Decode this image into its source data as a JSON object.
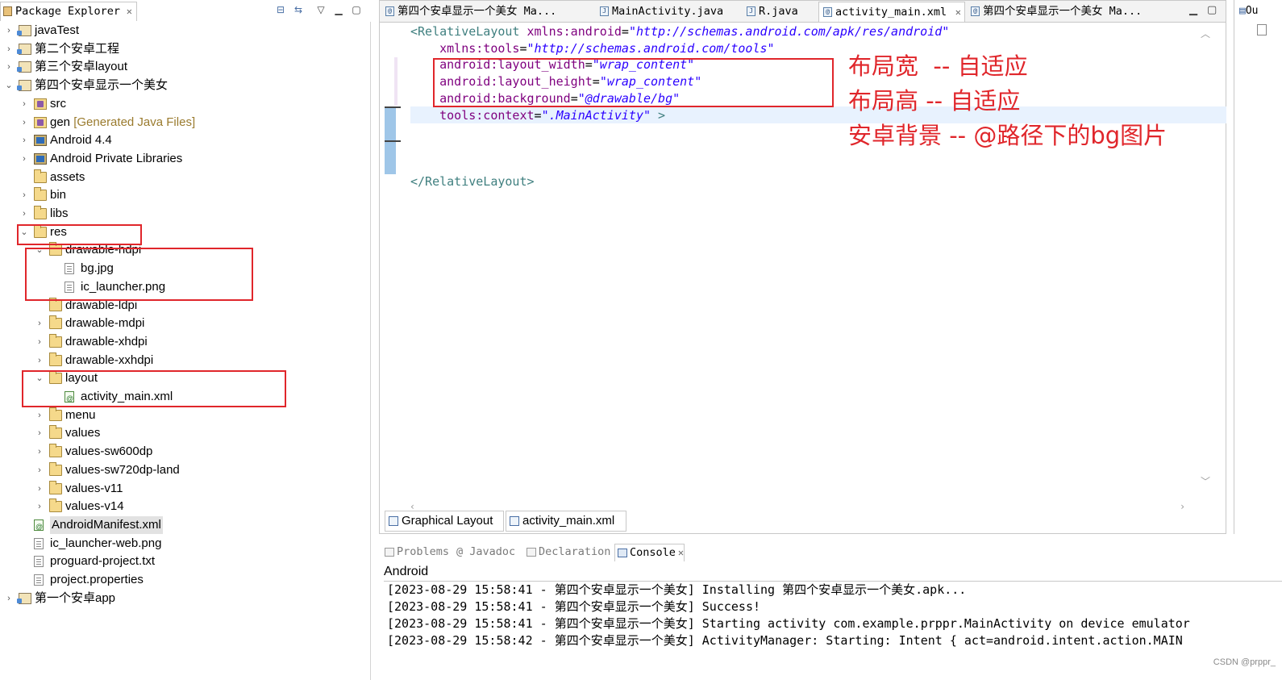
{
  "explorer": {
    "tab_label": "Package Explorer",
    "tree": [
      {
        "label": "javaTest",
        "icon": "project-icon",
        "arrow": "›"
      },
      {
        "label": "第二个安卓工程",
        "icon": "project-icon",
        "arrow": "›"
      },
      {
        "label": "第三个安卓layout",
        "icon": "project-icon",
        "arrow": "›"
      },
      {
        "label": "第四个安卓显示一个美女",
        "icon": "project-icon",
        "arrow": "⌄"
      },
      {
        "label": "src",
        "icon": "source-folder-icon",
        "arrow": "›"
      },
      {
        "label": "gen",
        "deco": "[Generated Java Files]",
        "icon": "source-folder-icon",
        "arrow": "›"
      },
      {
        "label": "Android 4.4",
        "icon": "library-icon",
        "arrow": "›"
      },
      {
        "label": "Android Private Libraries",
        "icon": "library-icon",
        "arrow": "›"
      },
      {
        "label": "assets",
        "icon": "folder-icon",
        "arrow": ""
      },
      {
        "label": "bin",
        "icon": "folder-icon",
        "arrow": "›"
      },
      {
        "label": "libs",
        "icon": "folder-icon",
        "arrow": "›"
      },
      {
        "label": "res",
        "icon": "folder-icon",
        "arrow": "⌄"
      },
      {
        "label": "drawable-hdpi",
        "icon": "folder-icon",
        "arrow": "⌄"
      },
      {
        "label": "bg.jpg",
        "icon": "file-icon",
        "arrow": ""
      },
      {
        "label": "ic_launcher.png",
        "icon": "file-icon",
        "arrow": ""
      },
      {
        "label": "drawable-ldpi",
        "icon": "folder-icon",
        "arrow": ""
      },
      {
        "label": "drawable-mdpi",
        "icon": "folder-icon",
        "arrow": "›"
      },
      {
        "label": "drawable-xhdpi",
        "icon": "folder-icon",
        "arrow": "›"
      },
      {
        "label": "drawable-xxhdpi",
        "icon": "folder-icon",
        "arrow": "›"
      },
      {
        "label": "layout",
        "icon": "folder-icon",
        "arrow": "⌄"
      },
      {
        "label": "activity_main.xml",
        "icon": "xml-file-icon",
        "arrow": ""
      },
      {
        "label": "menu",
        "icon": "folder-icon",
        "arrow": "›"
      },
      {
        "label": "values",
        "icon": "folder-icon",
        "arrow": "›"
      },
      {
        "label": "values-sw600dp",
        "icon": "folder-icon",
        "arrow": "›"
      },
      {
        "label": "values-sw720dp-land",
        "icon": "folder-icon",
        "arrow": "›"
      },
      {
        "label": "values-v11",
        "icon": "folder-icon",
        "arrow": "›"
      },
      {
        "label": "values-v14",
        "icon": "folder-icon",
        "arrow": "›"
      },
      {
        "label": "AndroidManifest.xml",
        "icon": "xml-file-icon",
        "arrow": "",
        "selected": true
      },
      {
        "label": "ic_launcher-web.png",
        "icon": "file-icon",
        "arrow": ""
      },
      {
        "label": "proguard-project.txt",
        "icon": "file-icon",
        "arrow": ""
      },
      {
        "label": "project.properties",
        "icon": "file-icon",
        "arrow": ""
      },
      {
        "label": "第一个安卓app",
        "icon": "project-icon",
        "arrow": "›"
      }
    ]
  },
  "editor": {
    "tabs": [
      {
        "label": "第四个安卓显示一个美女 Ma...",
        "icon": "android-icon"
      },
      {
        "label": "MainActivity.java",
        "icon": "java-file-icon"
      },
      {
        "label": "R.java",
        "icon": "java-file-icon"
      },
      {
        "label": "activity_main.xml",
        "icon": "xml-file-icon",
        "active": true
      },
      {
        "label": "第四个安卓显示一个美女 Ma...",
        "icon": "android-icon"
      }
    ],
    "code": [
      [
        {
          "t": "<RelativeLayout ",
          "c": "tag"
        },
        {
          "t": "xmlns:android",
          "c": "attr"
        },
        {
          "t": "=",
          "c": "pun"
        },
        {
          "t": "\"http://schemas.android.com/apk/res/android\"",
          "c": "val"
        }
      ],
      [
        {
          "t": "    xmlns:tools",
          "c": "attr"
        },
        {
          "t": "=",
          "c": "pun"
        },
        {
          "t": "\"http://schemas.android.com/tools\"",
          "c": "val"
        }
      ],
      [
        {
          "t": "    android:layout_width",
          "c": "attr"
        },
        {
          "t": "=",
          "c": "pun"
        },
        {
          "t": "\"wrap_content\"",
          "c": "val"
        }
      ],
      [
        {
          "t": "    android:layout_height",
          "c": "attr"
        },
        {
          "t": "=",
          "c": "pun"
        },
        {
          "t": "\"wrap_content\"",
          "c": "val"
        }
      ],
      [
        {
          "t": "    android:background",
          "c": "attr"
        },
        {
          "t": "=",
          "c": "pun"
        },
        {
          "t": "\"@drawable/bg\"",
          "c": "val"
        }
      ],
      [
        {
          "t": "    tools:context",
          "c": "attr"
        },
        {
          "t": "=",
          "c": "pun"
        },
        {
          "t": "\".MainActivity\"",
          "c": "val"
        },
        {
          "t": " >",
          "c": "tag"
        }
      ],
      [],
      [],
      [],
      [
        {
          "t": "</RelativeLayout>",
          "c": "tag"
        }
      ]
    ],
    "annotations": [
      "布局宽  -- 自适应",
      "布局高 -- 自适应",
      "安卓背景 -- @路径下的bg图片"
    ],
    "bottom_tabs": [
      "Graphical Layout",
      "activity_main.xml"
    ]
  },
  "right_panel": {
    "tab_label": "Ou"
  },
  "console": {
    "tabs": [
      {
        "label": "Problems",
        "icon": "problems-icon"
      },
      {
        "label": "@ Javadoc",
        "icon": ""
      },
      {
        "label": "Declaration",
        "icon": "declaration-icon"
      },
      {
        "label": "Console",
        "icon": "console-icon",
        "active": true
      }
    ],
    "name": "Android",
    "lines": [
      "[2023-08-29 15:58:41 - 第四个安卓显示一个美女] Installing 第四个安卓显示一个美女.apk...",
      "[2023-08-29 15:58:41 - 第四个安卓显示一个美女] Success!",
      "[2023-08-29 15:58:41 - 第四个安卓显示一个美女] Starting activity com.example.prppr.MainActivity on device emulator",
      "[2023-08-29 15:58:42 - 第四个安卓显示一个美女] ActivityManager: Starting: Intent { act=android.intent.action.MAIN"
    ],
    "watermark": "CSDN @prppr_"
  },
  "colors": {
    "annotation": "#e0262b",
    "xml_tag": "#3f7f7f",
    "xml_attr": "#7f007f",
    "xml_value": "#2a00ff"
  }
}
